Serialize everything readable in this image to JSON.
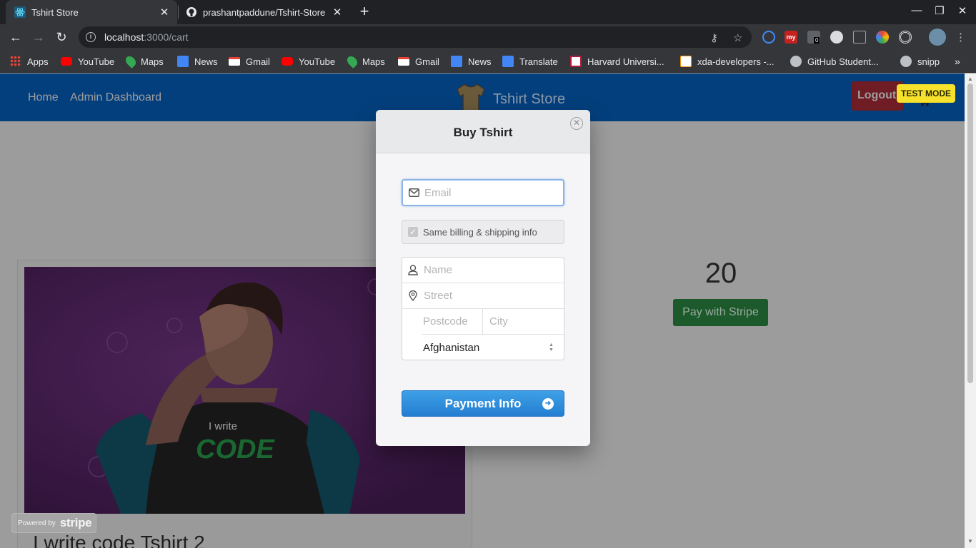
{
  "browser": {
    "tabs": [
      {
        "title": "Tshirt Store",
        "active": true
      },
      {
        "title": "prashantpaddune/Tshirt-Store",
        "active": false
      }
    ],
    "url_host": "localhost",
    "url_path": ":3000/cart",
    "bookmarks": [
      "Apps",
      "YouTube",
      "Maps",
      "News",
      "Gmail",
      "YouTube",
      "Maps",
      "Gmail",
      "News",
      "Translate",
      "Harvard Universi...",
      "xda-developers -...",
      "GitHub Student...",
      "snipp"
    ],
    "extension_badge": "0"
  },
  "navbar": {
    "links": [
      "Home",
      "Admin Dashboard"
    ],
    "brand": "Tshirt Store",
    "logout_label": "Logout",
    "test_mode_label": "TEST MODE"
  },
  "product": {
    "title": "I write code Tshirt 2",
    "shirt_text_top": "I write",
    "shirt_text_main": "CODE",
    "price": "20",
    "pay_button_label": "Pay with Stripe"
  },
  "stripe_badge": {
    "prefix": "Powered by",
    "logo": "stripe"
  },
  "checkout_modal": {
    "title": "Buy Tshirt",
    "email_placeholder": "Email",
    "same_info_label": "Same billing & shipping info",
    "same_info_checked": true,
    "name_placeholder": "Name",
    "street_placeholder": "Street",
    "postcode_placeholder": "Postcode",
    "city_placeholder": "City",
    "country_selected": "Afghanistan",
    "submit_label": "Payment Info"
  },
  "colors": {
    "navbar": "#043f7d",
    "logout": "#6f1c24",
    "test_mode": "#f6e12c",
    "pay_with_stripe": "#1c5a2c",
    "payment_info": "#237ed1"
  }
}
